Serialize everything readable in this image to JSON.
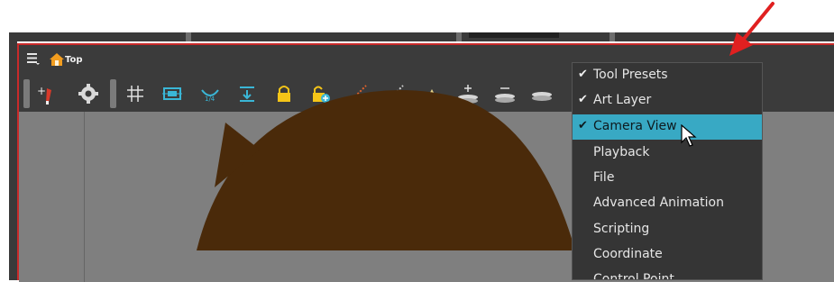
{
  "window": {
    "title": "Top"
  },
  "toolbar": {
    "tools": [
      {
        "icon": "add-brush-icon"
      },
      {
        "icon": "gear-icon"
      },
      {
        "icon": "grid-icon"
      },
      {
        "icon": "safe-area-icon"
      },
      {
        "icon": "onion-skin-icon"
      },
      {
        "icon": "align-layer-icon"
      },
      {
        "icon": "lock-icon"
      },
      {
        "icon": "unlock-icon"
      },
      {
        "icon": "pencil-line-icon"
      },
      {
        "icon": "line-icon"
      },
      {
        "icon": "light-icon"
      },
      {
        "icon": "add-layer-icon"
      },
      {
        "icon": "remove-layer-icon"
      },
      {
        "icon": "layer-stack-icon"
      }
    ]
  },
  "dropdown": {
    "items": [
      {
        "label": "Tool Presets",
        "checked": "✔"
      },
      {
        "label": "Art Layer",
        "checked": "✔"
      },
      {
        "label": "Camera View",
        "checked": "✔",
        "highlighted": true
      },
      {
        "label": "Playback",
        "checked": ""
      },
      {
        "label": "File",
        "checked": ""
      },
      {
        "label": "Advanced Animation",
        "checked": ""
      },
      {
        "label": "Scripting",
        "checked": ""
      },
      {
        "label": "Coordinate",
        "checked": ""
      },
      {
        "label": "Control Point",
        "checked": ""
      }
    ]
  },
  "colors": {
    "accent_highlight": "#38a9c4",
    "annotation_arrow": "#e02020",
    "window_border": "#c92a2a",
    "canvas": "#7f7f7f",
    "hair": "#4a2a0a"
  }
}
